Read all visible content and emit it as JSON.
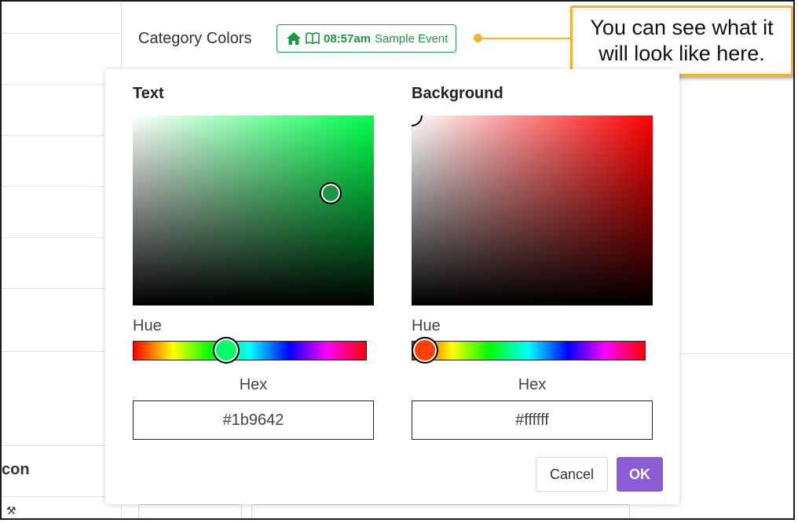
{
  "page": {
    "category_label": "Category Colors",
    "left_partial_label": "con",
    "preview": {
      "time": "08:57am",
      "title": "Sample Event",
      "text_color": "#1b9642",
      "icons": [
        "home-icon",
        "book-icon"
      ]
    },
    "callout_text": "You can see what it will look like here."
  },
  "picker": {
    "text_panel": {
      "title": "Text",
      "hue_label": "Hue",
      "hex_label": "Hex",
      "hex_value": "#1b9642",
      "field_hue_color": "#00ff4c",
      "selected_color": "#1b9642",
      "hue_fraction": 0.4,
      "saturation": 0.82,
      "value": 0.59
    },
    "background_panel": {
      "title": "Background",
      "hue_label": "Hue",
      "hex_label": "Hex",
      "hex_value": "#ffffff",
      "field_hue_color": "#ff0000",
      "selected_color": "#ffffff",
      "hue_fraction": 0.0,
      "saturation": 0.0,
      "value": 1.0
    },
    "buttons": {
      "cancel": "Cancel",
      "ok": "OK"
    },
    "colors": {
      "accent": "#8a5cd6",
      "callout_border": "#f2b330"
    }
  }
}
